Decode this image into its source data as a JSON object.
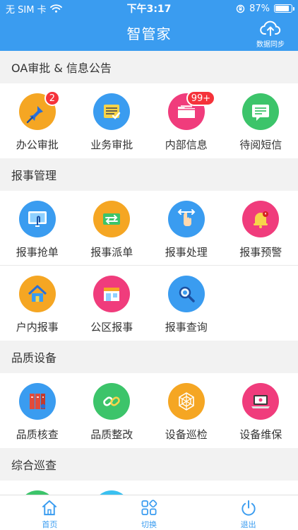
{
  "status_bar": {
    "carrier": "无 SIM 卡",
    "time": "下午3:17",
    "battery": "87%",
    "battery_level": 0.87
  },
  "header": {
    "title": "智管家",
    "sync_label": "数据同步"
  },
  "sections": [
    {
      "title": "OA审批 & 信息公告",
      "rows": [
        [
          {
            "label": "办公审批",
            "icon": "pushpin-icon",
            "color": "#f5a623",
            "badge": "2"
          },
          {
            "label": "业务审批",
            "icon": "checklist-card-icon",
            "color": "#3a9cf0"
          },
          {
            "label": "内部信息",
            "icon": "folder-icon",
            "color": "#f03c7c",
            "badge": "99+"
          },
          {
            "label": "待阅短信",
            "icon": "message-icon",
            "color": "#3cc46a"
          }
        ]
      ]
    },
    {
      "title": "报事管理",
      "rows": [
        [
          {
            "label": "报事抢单",
            "icon": "touch-screen-icon",
            "color": "#3a9cf0"
          },
          {
            "label": "报事派单",
            "icon": "transfer-icon",
            "color": "#f5a623"
          },
          {
            "label": "报事处理",
            "icon": "hand-swipe-icon",
            "color": "#3a9cf0"
          },
          {
            "label": "报事预警",
            "icon": "bell-alert-icon",
            "color": "#f03c7c"
          }
        ],
        [
          {
            "label": "户内报事",
            "icon": "house-icon",
            "color": "#f5a623"
          },
          {
            "label": "公区报事",
            "icon": "storefront-icon",
            "color": "#f03c7c"
          },
          {
            "label": "报事查询",
            "icon": "magnifier-icon",
            "color": "#3a9cf0"
          }
        ]
      ]
    },
    {
      "title": "品质设备",
      "rows": [
        [
          {
            "label": "品质核查",
            "icon": "binders-icon",
            "color": "#3a9cf0"
          },
          {
            "label": "品质整改",
            "icon": "chain-link-icon",
            "color": "#3cc46a"
          },
          {
            "label": "设备巡检",
            "icon": "spiderweb-icon",
            "color": "#f5a623"
          },
          {
            "label": "设备维保",
            "icon": "laptop-icon",
            "color": "#f03c7c"
          }
        ]
      ]
    },
    {
      "title": "综合巡查",
      "rows": [
        [
          {
            "label": "",
            "icon": "patrol-icon",
            "color": "#3cc46a"
          },
          {
            "label": "",
            "icon": "patrol-icon",
            "color": "#3ac0f0"
          }
        ]
      ]
    }
  ],
  "tabbar": [
    {
      "label": "首页",
      "icon": "home-icon"
    },
    {
      "label": "切换",
      "icon": "grid-switch-icon"
    },
    {
      "label": "退出",
      "icon": "power-icon"
    }
  ]
}
